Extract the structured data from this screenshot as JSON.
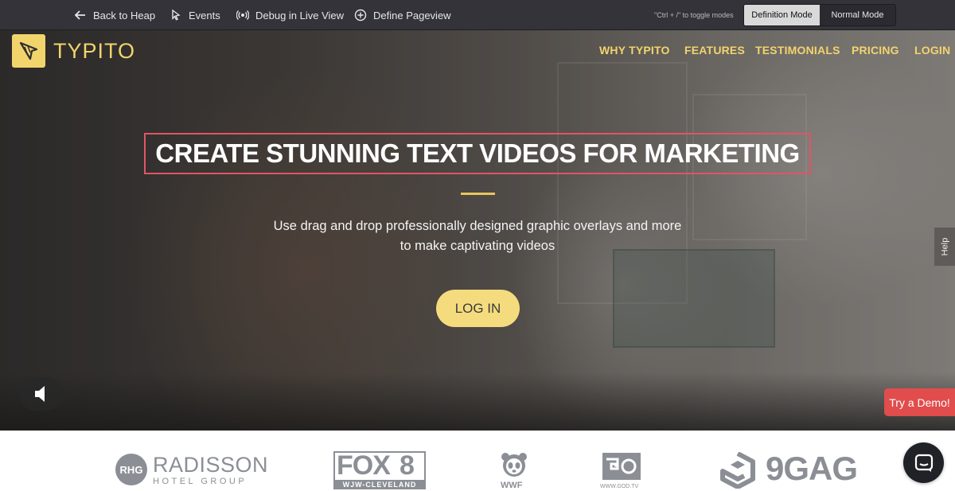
{
  "heap_toolbar": {
    "back_label": "Back to Heap",
    "events_label": "Events",
    "debug_label": "Debug in Live View",
    "pageview_label": "Define Pageview",
    "hint": "\"Ctrl + /\" to toggle modes",
    "definition_mode": "Definition Mode",
    "normal_mode": "Normal Mode"
  },
  "site": {
    "logo_text": "TYPITO",
    "nav": [
      "WHY TYPITO",
      "FEATURES",
      "TESTIMONIALS",
      "PRICING",
      "LOGIN"
    ]
  },
  "hero": {
    "headline": "CREATE STUNNING TEXT VIDEOS FOR MARKETING",
    "subtext_line1": "Use drag and drop professionally designed graphic overlays and more",
    "subtext_line2": "to make captivating videos",
    "cta": "LOG IN"
  },
  "help_tab": "Help",
  "demo_button": "Try a Demo!",
  "client_logos": {
    "radisson_mark": "RHG",
    "radisson_name": "RADISSON",
    "radisson_sub": "HOTEL GROUP",
    "fox_name": "FOX",
    "fox_number": "8",
    "fox_sub": "WJW-CLEVELAND",
    "wwf": "WWF",
    "godtv": "WWW.GOD.TV",
    "ninegag": "9GAG"
  },
  "colors": {
    "accent_yellow": "#f2d46c",
    "toolbar_bg": "#343339",
    "demo_red": "#e04d4c",
    "highlight_border": "#e05566"
  }
}
